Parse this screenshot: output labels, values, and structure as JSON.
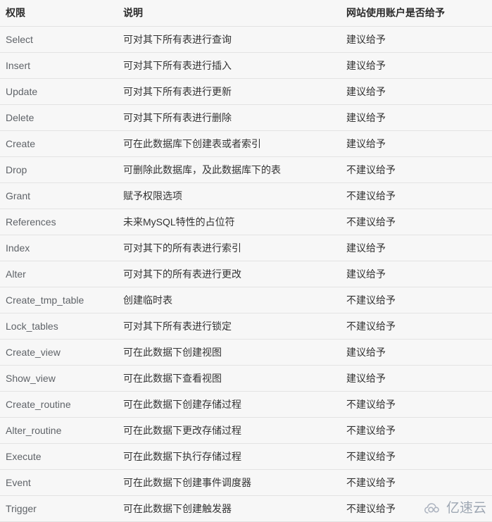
{
  "table": {
    "headers": [
      "权限",
      "说明",
      "网站使用账户是否给予"
    ],
    "rows": [
      {
        "privilege": "Select",
        "description": "可对其下所有表进行查询",
        "grant": "建议给予"
      },
      {
        "privilege": "Insert",
        "description": "可对其下所有表进行插入",
        "grant": "建议给予"
      },
      {
        "privilege": "Update",
        "description": "可对其下所有表进行更新",
        "grant": "建议给予"
      },
      {
        "privilege": "Delete",
        "description": "可对其下所有表进行删除",
        "grant": "建议给予"
      },
      {
        "privilege": "Create",
        "description": "可在此数据库下创建表或者索引",
        "grant": "建议给予"
      },
      {
        "privilege": "Drop",
        "description": "可删除此数据库，及此数据库下的表",
        "grant": "不建议给予"
      },
      {
        "privilege": "Grant",
        "description": "赋予权限选项",
        "grant": "不建议给予"
      },
      {
        "privilege": "References",
        "description": "未来MySQL特性的占位符",
        "grant": "不建议给予"
      },
      {
        "privilege": "Index",
        "description": "可对其下的所有表进行索引",
        "grant": "建议给予"
      },
      {
        "privilege": "Alter",
        "description": "可对其下的所有表进行更改",
        "grant": "建议给予"
      },
      {
        "privilege": "Create_tmp_table",
        "description": "创建临时表",
        "grant": "不建议给予"
      },
      {
        "privilege": "Lock_tables",
        "description": "可对其下所有表进行锁定",
        "grant": "不建议给予"
      },
      {
        "privilege": "Create_view",
        "description": "可在此数据下创建视图",
        "grant": "建议给予"
      },
      {
        "privilege": "Show_view",
        "description": "可在此数据下查看视图",
        "grant": "建议给予"
      },
      {
        "privilege": "Create_routine",
        "description": "可在此数据下创建存储过程",
        "grant": "不建议给予"
      },
      {
        "privilege": "Alter_routine",
        "description": "可在此数据下更改存储过程",
        "grant": "不建议给予"
      },
      {
        "privilege": "Execute",
        "description": "可在此数据下执行存储过程",
        "grant": "不建议给予"
      },
      {
        "privilege": "Event",
        "description": "可在此数据下创建事件调度器",
        "grant": "不建议给予"
      },
      {
        "privilege": "Trigger",
        "description": "可在此数据下创建触发器",
        "grant": "不建议给予"
      }
    ]
  },
  "watermark": {
    "text": "亿速云",
    "icon": "cloud-logo-icon"
  },
  "colors": {
    "background": "#f7f7f7",
    "row_border": "#e3e3e3",
    "header_text": "#2b2b2b",
    "privilege_text": "#5f6368",
    "body_text": "#333333",
    "watermark_text": "#9aa3b0"
  }
}
